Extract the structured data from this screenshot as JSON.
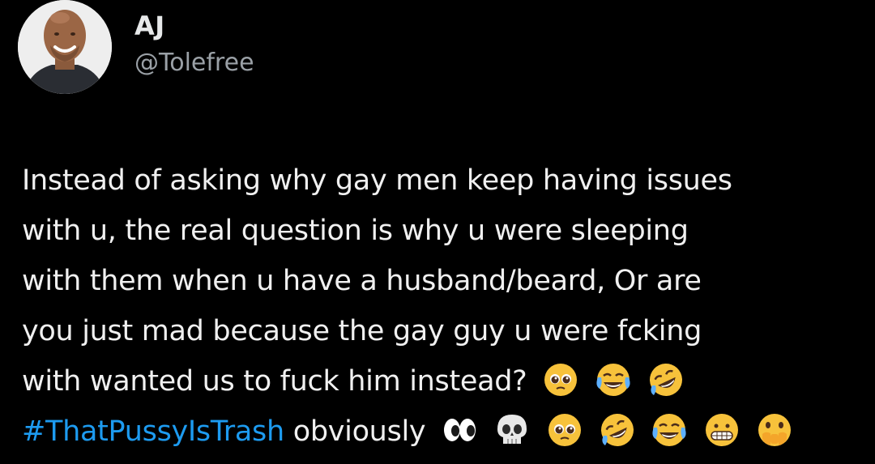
{
  "author": {
    "display_name": "AJ",
    "handle": "@Tolefree",
    "avatar_icon": "profile-photo-avatar"
  },
  "tweet": {
    "lines": [
      "Instead of asking why gay men keep having issues",
      "with u, the real question is why u were sleeping",
      "with them when u have a husband/beard, Or are",
      "you just mad because the gay guy u were fcking",
      "with wanted us to fuck him instead?"
    ],
    "hashtag": "#ThatPussyIsTrash",
    "trailing_text": "obviously",
    "emojis_line5": [
      "pleading-face-emoji",
      "face-with-tears-of-joy-emoji",
      "rolling-on-floor-laughing-emoji"
    ],
    "emojis_line6": [
      "eyes-emoji",
      "skull-emoji",
      "pleading-face-emoji",
      "rolling-on-floor-laughing-emoji",
      "face-with-tears-of-joy-emoji",
      "grimacing-face-emoji",
      "face-with-open-eyes-and-hand-over-mouth-emoji"
    ]
  },
  "colors": {
    "background": "#000000",
    "text": "#e7e9ea",
    "handle": "#9aa0a6",
    "hashtag": "#1d9bf0"
  }
}
